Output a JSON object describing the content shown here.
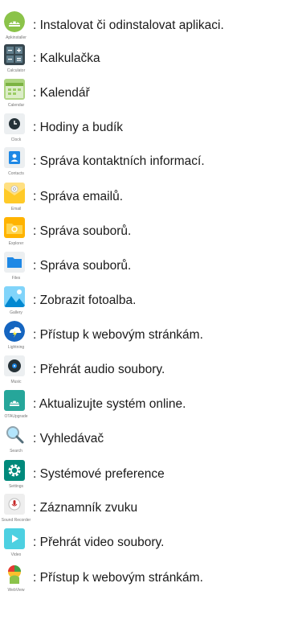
{
  "items": [
    {
      "caption": "Apkinstaller",
      "icon": "android-icon",
      "text": ": Instalovat či odinstalovat aplikaci."
    },
    {
      "caption": "Calculator",
      "icon": "calculator-icon",
      "text": ": Kalkulačka"
    },
    {
      "caption": "Calendar",
      "icon": "calendar-icon",
      "text": ": Kalendář"
    },
    {
      "caption": "Clock",
      "icon": "clock-icon",
      "text": ": Hodiny a budík"
    },
    {
      "caption": "Contacts",
      "icon": "contacts-icon",
      "text": ": Správa kontaktních informací."
    },
    {
      "caption": "Email",
      "icon": "email-icon",
      "text": ": Správa emailů."
    },
    {
      "caption": "Explorer",
      "icon": "explorer-icon",
      "text": ": Správa souborů."
    },
    {
      "caption": "Files",
      "icon": "files-icon",
      "text": ": Správa souborů."
    },
    {
      "caption": "Gallery",
      "icon": "gallery-icon",
      "text": ": Zobrazit fotoalba."
    },
    {
      "caption": "Lightning",
      "icon": "lightning-browser-icon",
      "text": ": Přístup k webovým stránkám."
    },
    {
      "caption": "Music",
      "icon": "music-icon",
      "text": ": Přehrát audio soubory."
    },
    {
      "caption": "OTAUpgrade",
      "icon": "ota-upgrade-icon",
      "text": ": Aktualizujte systém online."
    },
    {
      "caption": "Search",
      "icon": "search-icon",
      "text": ": Vyhledávač"
    },
    {
      "caption": "Settings",
      "icon": "settings-icon",
      "text": ": Systémové preference"
    },
    {
      "caption": "Sound Recorder",
      "icon": "sound-recorder-icon",
      "text": " : Záznamník zvuku"
    },
    {
      "caption": "Video",
      "icon": "video-icon",
      "text": ": Přehrát video soubory."
    },
    {
      "caption": "WebView",
      "icon": "webview-icon",
      "text": ": Přístup k webovým stránkám."
    }
  ]
}
